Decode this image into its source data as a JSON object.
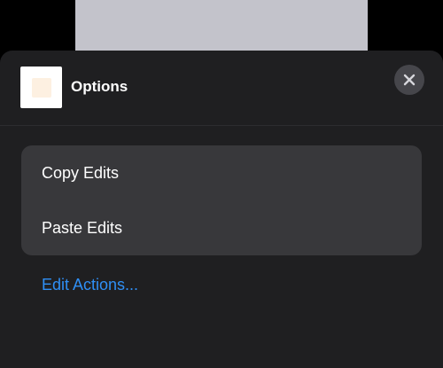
{
  "sheet": {
    "title": "Options",
    "close_icon": "close-icon"
  },
  "menu": {
    "items": [
      {
        "label": "Copy Edits"
      },
      {
        "label": "Paste Edits"
      }
    ]
  },
  "edit_actions": {
    "label": "Edit Actions..."
  },
  "colors": {
    "sheet_bg": "#1f1f21",
    "card_bg": "#38383b",
    "link": "#2f8ff5",
    "close_bg": "#46464b"
  }
}
